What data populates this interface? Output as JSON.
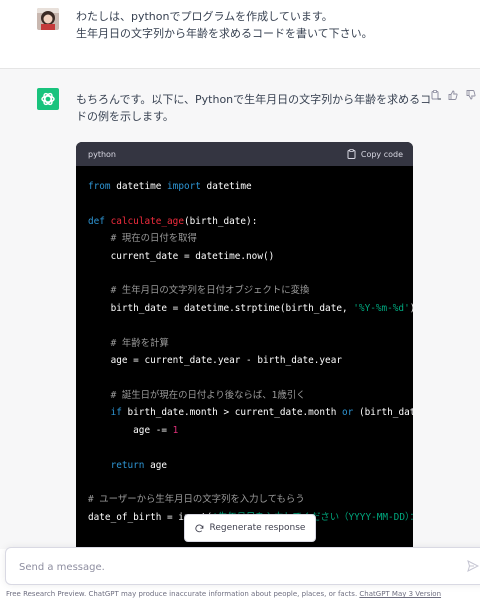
{
  "user_message": {
    "lines": [
      "わたしは、pythonでプログラムを作成しています。",
      "生年月日の文字列から年齢を求めるコードを書いて下さい。"
    ]
  },
  "assistant_message": {
    "lines": [
      "もちろんです。以下に、Pythonで生年月日の文字列から年齢を求めるコー",
      "ドの例を示します。"
    ]
  },
  "code_block": {
    "language": "python",
    "copy_label": "Copy code",
    "lines": [
      [
        {
          "t": "from",
          "c": "kw"
        },
        {
          "t": " datetime "
        },
        {
          "t": "import",
          "c": "kw"
        },
        {
          "t": " datetime"
        }
      ],
      [],
      [
        {
          "t": "def",
          "c": "kw"
        },
        {
          "t": " "
        },
        {
          "t": "calculate_age",
          "c": "fn"
        },
        {
          "t": "(birth_date):"
        }
      ],
      [
        {
          "t": "    "
        },
        {
          "t": "# 現在の日付を取得",
          "c": "cm"
        }
      ],
      [
        {
          "t": "    current_date = datetime.now()"
        }
      ],
      [],
      [
        {
          "t": "    "
        },
        {
          "t": "# 生年月日の文字列を日付オブジェクトに変換",
          "c": "cm"
        }
      ],
      [
        {
          "t": "    birth_date = datetime.strptime(birth_date, "
        },
        {
          "t": "'%Y-%m-%d'",
          "c": "st"
        },
        {
          "t": ")"
        }
      ],
      [],
      [
        {
          "t": "    "
        },
        {
          "t": "# 年齢を計算",
          "c": "cm"
        }
      ],
      [
        {
          "t": "    age = current_date.year - birth_date.year"
        }
      ],
      [],
      [
        {
          "t": "    "
        },
        {
          "t": "# 誕生日が現在の日付より後ならば、1歳引く",
          "c": "cm"
        }
      ],
      [
        {
          "t": "    "
        },
        {
          "t": "if",
          "c": "kw"
        },
        {
          "t": " birth_date.month > current_date.month "
        },
        {
          "t": "or",
          "c": "kw"
        },
        {
          "t": " (birth_date.month == current_date.month "
        },
        {
          "t": "and",
          "c": "kw"
        },
        {
          "t": " birth_date.day > current_date.day):"
        }
      ],
      [
        {
          "t": "        age -= "
        },
        {
          "t": "1",
          "c": "nm"
        }
      ],
      [],
      [
        {
          "t": "    "
        },
        {
          "t": "return",
          "c": "kw"
        },
        {
          "t": " age"
        }
      ],
      [],
      [
        {
          "t": "# ユーザーから生年月日の文字列を入力してもらう",
          "c": "cm"
        }
      ],
      [
        {
          "t": "date_of_birth = input("
        },
        {
          "t": "'生年月日を入力してください（YYYY-MM-DD）：'",
          "c": "st"
        },
        {
          "t": ")"
        }
      ]
    ]
  },
  "regenerate_label": "Regenerate response",
  "input": {
    "placeholder": "Send a message."
  },
  "footer": {
    "text": "Free Research Preview. ChatGPT may produce inaccurate information about people, places, or facts. ",
    "link": "ChatGPT May 3 Version"
  }
}
